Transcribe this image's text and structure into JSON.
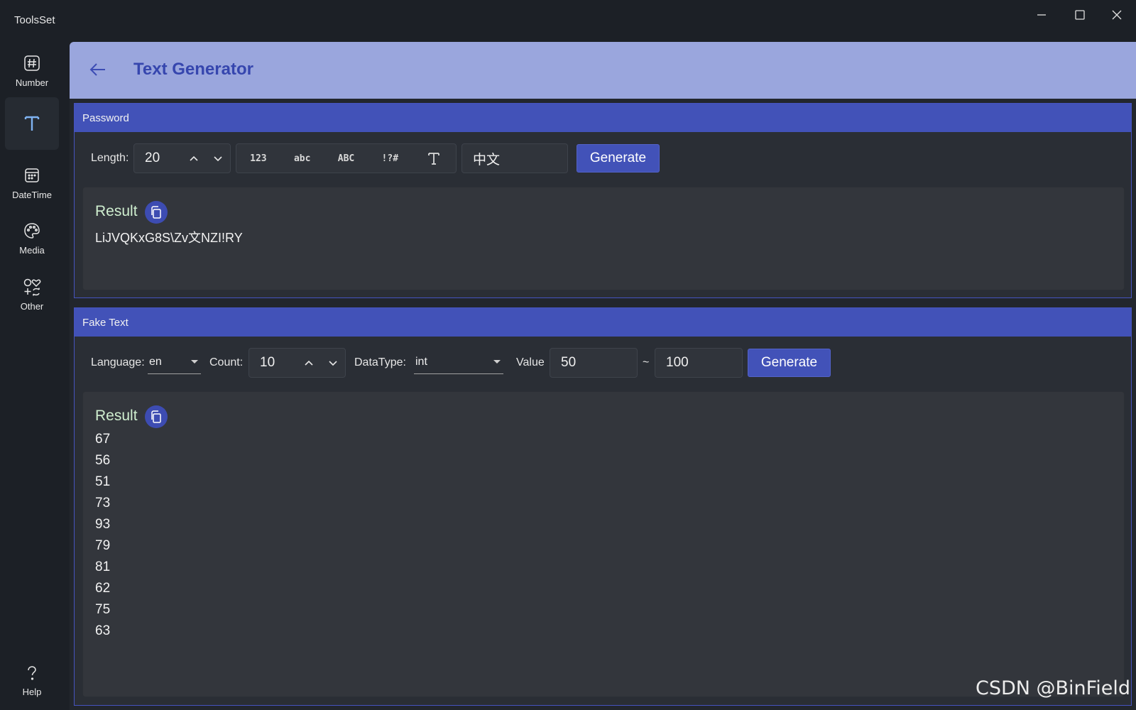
{
  "window": {
    "title": "ToolsSet"
  },
  "sidebar": {
    "items": [
      {
        "label": "Number",
        "icon": "hash-icon"
      },
      {
        "label": "",
        "icon": "text-icon"
      },
      {
        "label": "DateTime",
        "icon": "calendar-icon"
      },
      {
        "label": "Media",
        "icon": "palette-icon"
      },
      {
        "label": "Other",
        "icon": "shapes-icon"
      }
    ],
    "help": {
      "label": "Help",
      "icon": "question-icon"
    }
  },
  "header": {
    "title": "Text Generator"
  },
  "password": {
    "title": "Password",
    "length_label": "Length:",
    "length_value": "20",
    "toggles": [
      "123",
      "abc",
      "ABC",
      "!?#",
      "T"
    ],
    "custom_chars": "中文",
    "generate_label": "Generate",
    "result_title": "Result",
    "result_value": "LiJVQKxG8S\\Zv文NZI!RY"
  },
  "fake_text": {
    "title": "Fake Text",
    "language_label": "Language:",
    "language_value": "en",
    "count_label": "Count:",
    "count_value": "10",
    "datatype_label": "DataType:",
    "datatype_value": "int",
    "value_label": "Value",
    "value_min": "50",
    "range_sep": "~",
    "value_max": "100",
    "generate_label": "Generate",
    "result_title": "Result",
    "results": [
      "67",
      "56",
      "51",
      "73",
      "93",
      "79",
      "81",
      "62",
      "75",
      "63"
    ]
  },
  "watermark": "CSDN @BinField",
  "colors": {
    "accent": "#4252b8",
    "header_band": "#9aa6dd",
    "nav_active": "#7fb3f2"
  }
}
